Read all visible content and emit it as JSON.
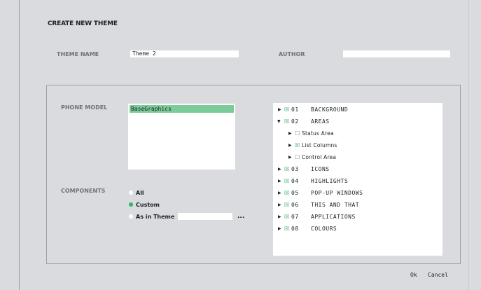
{
  "dialog": {
    "title": "CREATE NEW THEME"
  },
  "theme_name": {
    "label": "THEME NAME",
    "value": "Theme 2"
  },
  "author": {
    "label": "AUTHOR",
    "value": ""
  },
  "phone_model": {
    "label": "PHONE MODEL",
    "options": [
      "BaseGraphics"
    ],
    "selected": "BaseGraphics"
  },
  "components": {
    "label": "COMPONENTS",
    "options": [
      {
        "label": "All",
        "checked": false
      },
      {
        "label": "Custom",
        "checked": true
      },
      {
        "label": "As in Theme",
        "checked": false
      }
    ],
    "as_in_theme_value": "",
    "browse_label": "..."
  },
  "tree": {
    "items": [
      {
        "num": "01",
        "label": "BACKGROUND",
        "checked": true,
        "expanded": false
      },
      {
        "num": "02",
        "label": "AREAS",
        "checked": true,
        "expanded": true,
        "children": [
          {
            "label": "Status Area",
            "checked": false
          },
          {
            "label": "List Columns",
            "checked": true
          },
          {
            "label": "Control Area",
            "checked": false
          }
        ]
      },
      {
        "num": "03",
        "label": "ICONS",
        "checked": true,
        "expanded": false
      },
      {
        "num": "04",
        "label": "HIGHLIGHTS",
        "checked": true,
        "expanded": false
      },
      {
        "num": "05",
        "label": "POP-UP WINDOWS",
        "checked": true,
        "expanded": false
      },
      {
        "num": "06",
        "label": "THIS AND THAT",
        "checked": true,
        "expanded": false
      },
      {
        "num": "07",
        "label": "APPLICATIONS",
        "checked": true,
        "expanded": false
      },
      {
        "num": "08",
        "label": "COLOURS",
        "checked": true,
        "expanded": false
      }
    ]
  },
  "buttons": {
    "ok": "Ok",
    "cancel": "Cancel"
  },
  "icons": {
    "collapsed": "triangle-right-icon",
    "expanded": "triangle-down-icon",
    "checked": "checked-box-icon",
    "unchecked": "empty-box-icon",
    "radio_on": "radio-selected-icon",
    "radio_off": "radio-empty-icon"
  },
  "colors": {
    "background": "#d9dbdf",
    "accent_green": "#2db56a",
    "selection_green": "#7ccc9a",
    "label_gray": "#6d7378"
  }
}
